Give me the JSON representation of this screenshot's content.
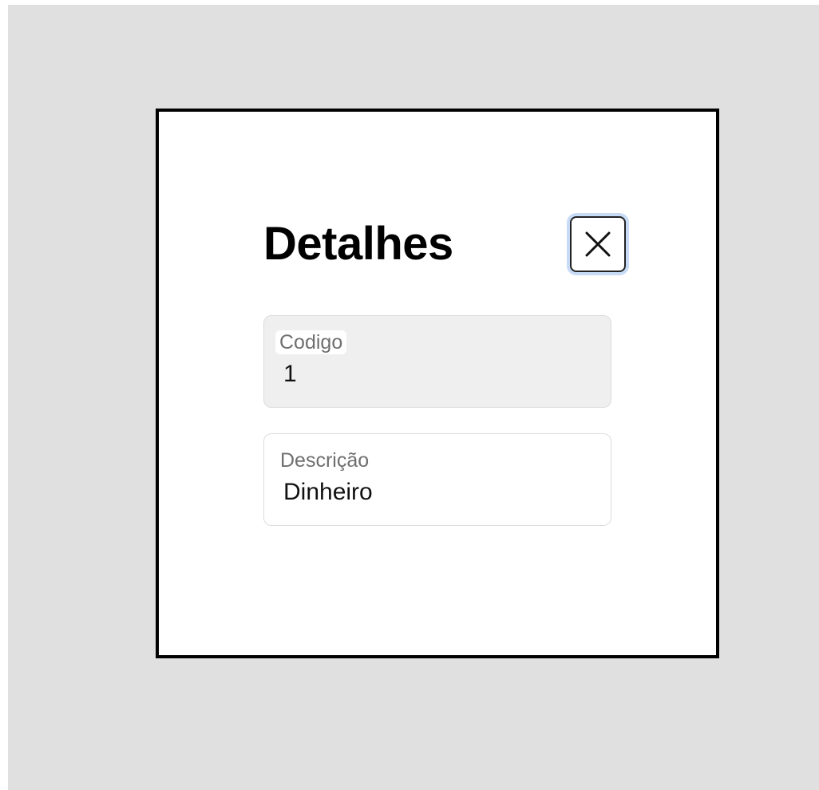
{
  "modal": {
    "title": "Detalhes",
    "close_icon": "close-icon",
    "fields": [
      {
        "label": "Codigo",
        "value": "1",
        "readonly": true
      },
      {
        "label": "Descrição",
        "value": "Dinheiro",
        "readonly": false
      }
    ]
  },
  "colors": {
    "backdrop": "#e0e0e0",
    "modal_background": "#ffffff",
    "modal_border": "#000000",
    "focus_ring": "#c7dbf7",
    "readonly_field_background": "#efefef"
  }
}
